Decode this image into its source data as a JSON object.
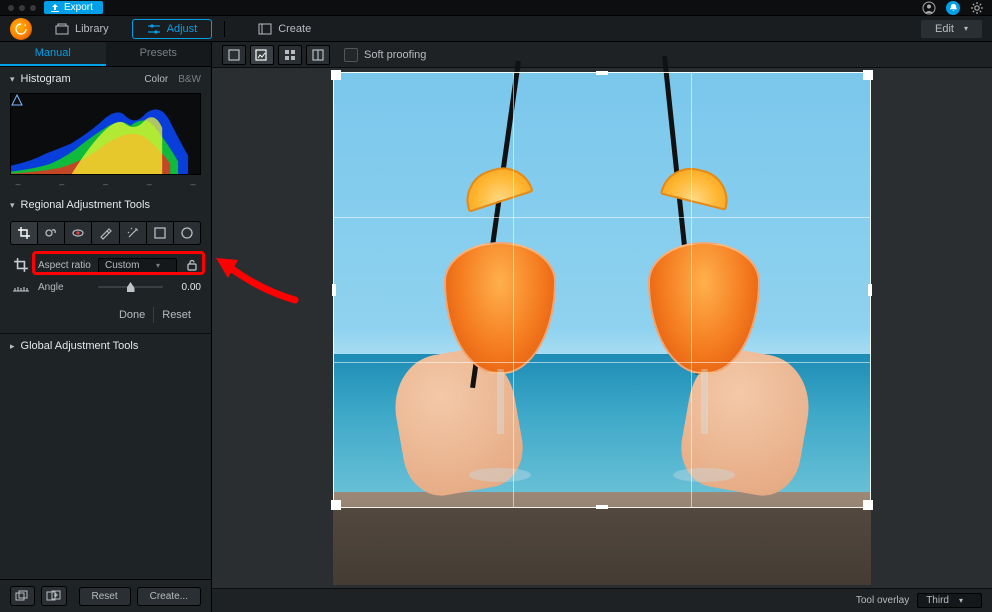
{
  "titlebar": {
    "export_label": "Export"
  },
  "modes": {
    "library": "Library",
    "adjust": "Adjust",
    "create": "Create",
    "edit_dropdown": "Edit"
  },
  "sidebar": {
    "tabs": {
      "manual": "Manual",
      "presets": "Presets"
    },
    "histogram": {
      "title": "Histogram",
      "color": "Color",
      "bw": "B&W"
    },
    "regional": {
      "title": "Regional Adjustment Tools",
      "aspect_label": "Aspect ratio",
      "aspect_value": "Custom",
      "angle_label": "Angle",
      "angle_value": "0.00",
      "done": "Done",
      "reset": "Reset"
    },
    "global": {
      "title": "Global Adjustment Tools"
    },
    "footer": {
      "reset": "Reset",
      "create": "Create..."
    }
  },
  "canvas_top": {
    "soft_proofing": "Soft proofing"
  },
  "canvas_footer": {
    "tool_overlay_label": "Tool overlay",
    "tool_overlay_value": "Third"
  }
}
